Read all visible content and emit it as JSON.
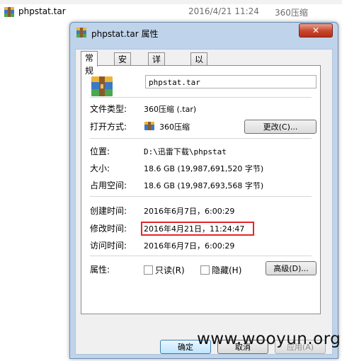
{
  "explorer": {
    "file_name": "phpstat.tar",
    "file_date": "2016/4/21 11:24",
    "file_type": "360压缩"
  },
  "dialog": {
    "title": "phpstat.tar 属性",
    "close_label": "✕",
    "tabs": [
      "常规",
      "安全",
      "详细信息",
      "以前的版本"
    ],
    "active_tab": "常规",
    "file_name_value": "phpstat.tar",
    "fields": {
      "type_label": "文件类型:",
      "type_value": "360压缩 (.tar)",
      "open_label": "打开方式:",
      "open_value": "360压缩",
      "change_button": "更改(C)...",
      "location_label": "位置:",
      "location_value": "D:\\迅雷下载\\phpstat",
      "size_label": "大小:",
      "size_value": "18.6 GB (19,987,691,520 字节)",
      "disk_label": "占用空间:",
      "disk_value": "18.6 GB (19,987,693,568 字节)",
      "created_label": "创建时间:",
      "created_value": "2016年6月7日，6:00:29",
      "modified_label": "修改时间:",
      "modified_value": "2016年4月21日，11:24:47",
      "accessed_label": "访问时间:",
      "accessed_value": "2016年6月7日，6:00:29",
      "attributes_label": "属性:",
      "readonly_label": "只读(R)",
      "hidden_label": "隐藏(H)",
      "advanced_button": "高级(D)..."
    },
    "buttons": {
      "ok": "确定",
      "cancel": "取消",
      "apply": "应用(A)"
    }
  },
  "watermark": "www.wooyun.org",
  "colors": {
    "highlight_border": "#e8242a",
    "dialog_frame": "#bfd3ea",
    "close_button": "#c8452b"
  }
}
